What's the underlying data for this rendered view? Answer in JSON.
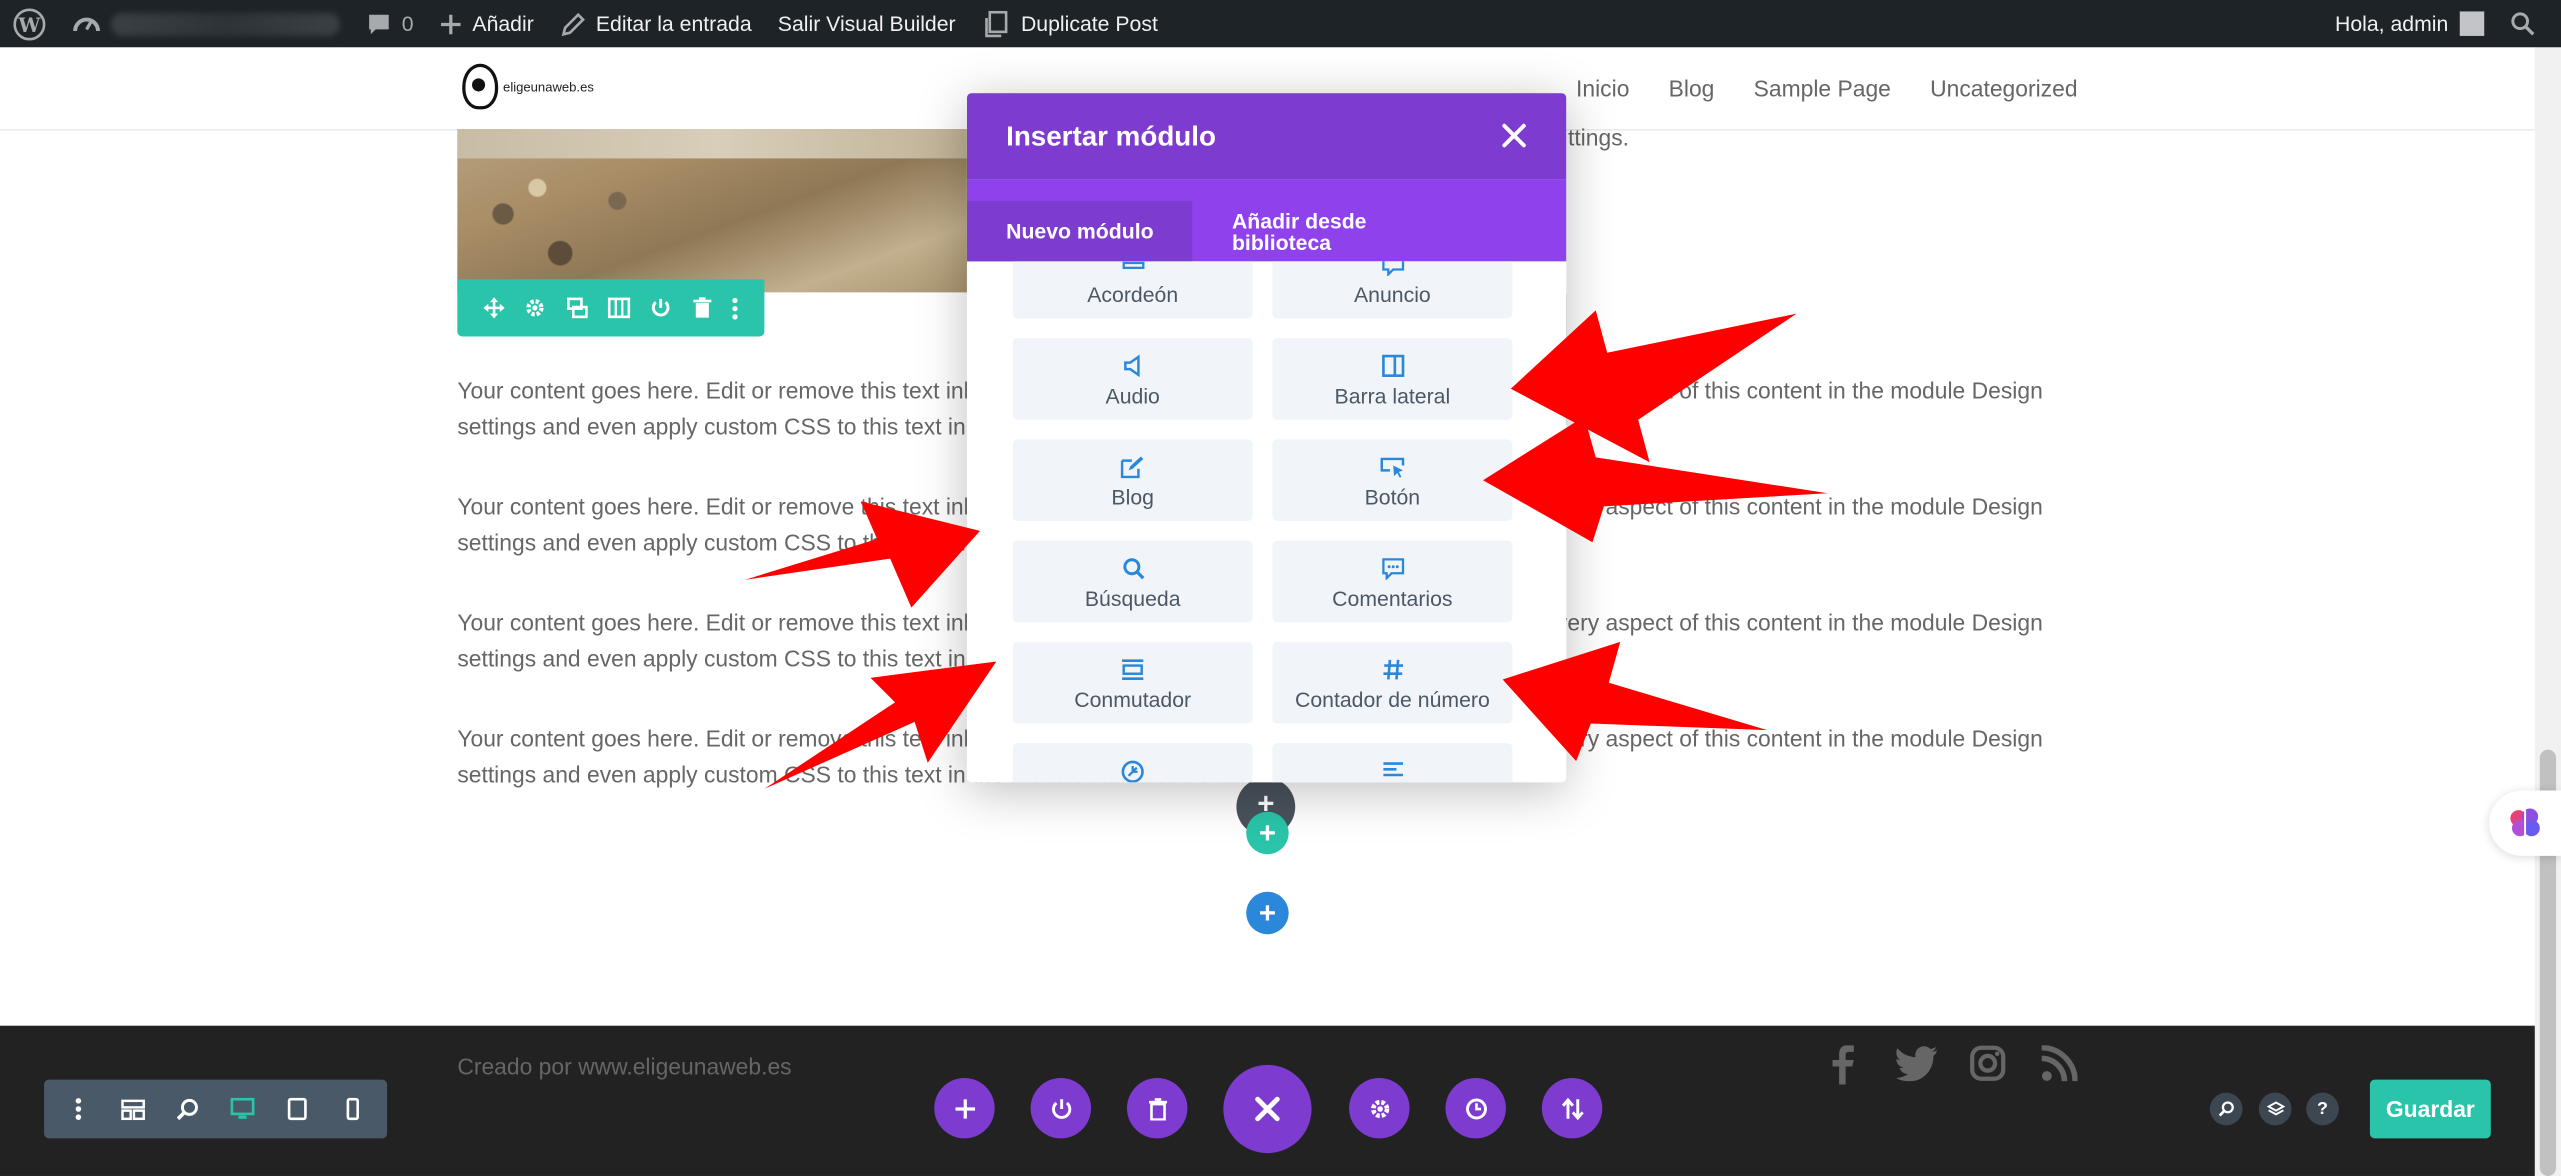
{
  "adminbar": {
    "comments_count": "0",
    "add_label": "Añadir",
    "edit_label": "Editar la entrada",
    "exit_label": "Salir Visual Builder",
    "duplicate_label": "Duplicate Post",
    "greeting": "Hola, admin"
  },
  "header": {
    "logo_text": "eligeunaweb.es",
    "nav": [
      "Inicio",
      "Blog",
      "Sample Page",
      "Uncategorized"
    ]
  },
  "content": {
    "tail_text": "ttings.",
    "paragraphs": [
      "Your content goes here. Edit or remove this text inline or in the module Content settings. You can also style every aspect of this content in the module Design settings and even apply custom CSS to this text in the module Advanced settings.",
      "Your content goes here. Edit or remove this text inline or in the module Content settings. You can also style every aspect of this content in the module Design settings and even apply custom CSS to this text in the module Advanced settings.",
      "Your content goes here. Edit or remove this text inline or in the module Content settings. You can also style every aspect of this content in the module Design settings and even apply custom CSS to this text in the module Advanced settings.",
      "Your content goes here. Edit or remove this text inline or in the module Content settings. You can also style every aspect of this content in the module Design settings and even apply custom CSS to this text in the module Advanced settings."
    ]
  },
  "modal": {
    "title": "Insertar módulo",
    "tabs": [
      "Nuevo módulo",
      "Añadir desde biblioteca"
    ],
    "modules": [
      {
        "label": "Acordeón",
        "icon": "accordion-icon"
      },
      {
        "label": "Anuncio",
        "icon": "announcement-icon"
      },
      {
        "label": "Audio",
        "icon": "audio-icon"
      },
      {
        "label": "Barra lateral",
        "icon": "sidebar-icon"
      },
      {
        "label": "Blog",
        "icon": "blog-icon"
      },
      {
        "label": "Botón",
        "icon": "button-icon"
      },
      {
        "label": "Búsqueda",
        "icon": "search-icon"
      },
      {
        "label": "Comentarios",
        "icon": "comments-icon"
      },
      {
        "label": "Conmutador",
        "icon": "toggle-icon"
      },
      {
        "label": "Contador de número",
        "icon": "hash-icon"
      },
      {
        "label": "",
        "icon": "countdown-icon"
      },
      {
        "label": "",
        "icon": "text-icon"
      }
    ]
  },
  "footer": {
    "credit": "Creado por www.eligeunaweb.es",
    "save_label": "Guardar"
  },
  "colors": {
    "divi_purple": "#7e3bd0",
    "divi_teal": "#29c4a9",
    "divi_blue": "#2b87da",
    "arrow_red": "#ff0000"
  }
}
